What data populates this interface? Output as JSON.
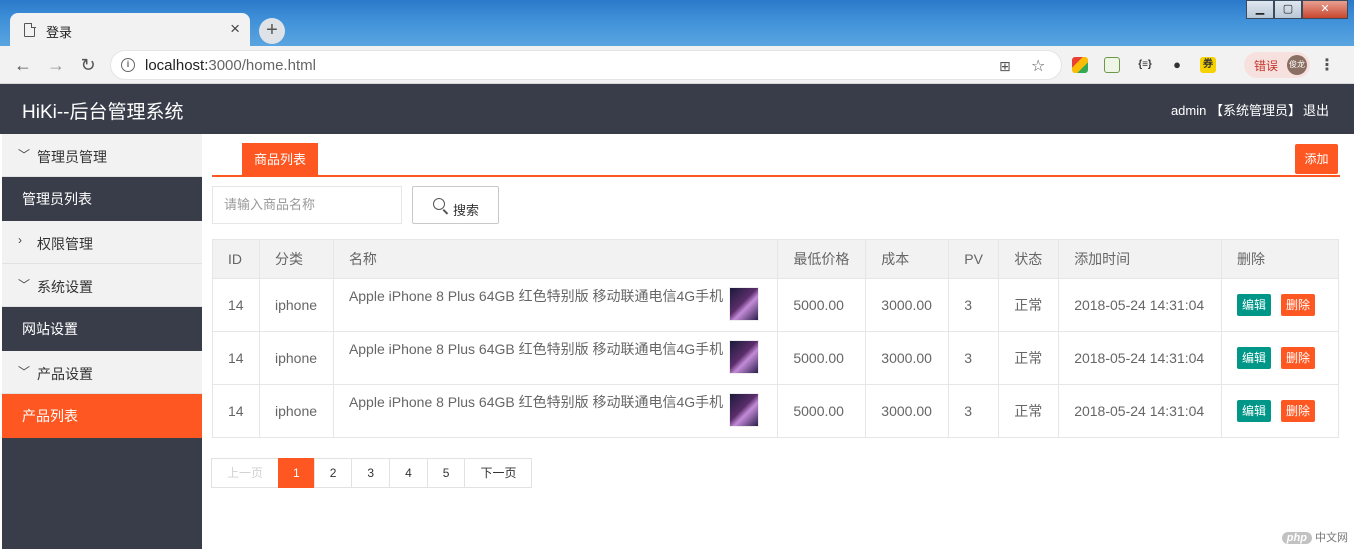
{
  "browser": {
    "tab_title": "登录",
    "tab_close": "×",
    "new_tab": "+",
    "url_host": "localhost:",
    "url_path": "3000/home.html",
    "profile_label": "错误",
    "avatar_text": "俊龙"
  },
  "app": {
    "title": "HiKi--后台管理系统",
    "user": "admin 【系统管理员】",
    "logout": "退出"
  },
  "sidebar": {
    "groups": [
      {
        "label": "管理员管理",
        "expanded": true
      },
      {
        "label": "权限管理",
        "expanded": false
      },
      {
        "label": "系统设置",
        "expanded": true
      },
      {
        "label": "产品设置",
        "expanded": true
      }
    ],
    "items": [
      {
        "label": "管理员列表"
      },
      {
        "label": "网站设置"
      },
      {
        "label": "产品列表",
        "active": true
      }
    ]
  },
  "main": {
    "tab_label": "商品列表",
    "add_label": "添加",
    "search_placeholder": "请输入商品名称",
    "search_label": "搜索"
  },
  "table": {
    "headers": [
      "ID",
      "分类",
      "名称",
      "最低价格",
      "成本",
      "PV",
      "状态",
      "添加时间",
      "删除"
    ],
    "rows": [
      {
        "id": "14",
        "category": "iphone",
        "name": "Apple iPhone 8 Plus 64GB 红色特别版 移动联通电信4G手机",
        "min_price": "5000.00",
        "cost": "3000.00",
        "pv": "3",
        "status": "正常",
        "added": "2018-05-24 14:31:04",
        "edit": "编辑",
        "delete": "删除"
      },
      {
        "id": "14",
        "category": "iphone",
        "name": "Apple iPhone 8 Plus 64GB 红色特别版 移动联通电信4G手机",
        "min_price": "5000.00",
        "cost": "3000.00",
        "pv": "3",
        "status": "正常",
        "added": "2018-05-24 14:31:04",
        "edit": "编辑",
        "delete": "删除"
      },
      {
        "id": "14",
        "category": "iphone",
        "name": "Apple iPhone 8 Plus 64GB 红色特别版 移动联通电信4G手机",
        "min_price": "5000.00",
        "cost": "3000.00",
        "pv": "3",
        "status": "正常",
        "added": "2018-05-24 14:31:04",
        "edit": "编辑",
        "delete": "删除"
      }
    ]
  },
  "pager": {
    "prev": "上一页",
    "pages": [
      "1",
      "2",
      "3",
      "4",
      "5"
    ],
    "current": "1",
    "next": "下一页"
  },
  "watermark": {
    "logo": "php",
    "text": "中文网"
  },
  "colors": {
    "accent": "#ff5722",
    "header": "#383d49",
    "edit": "#009688"
  }
}
